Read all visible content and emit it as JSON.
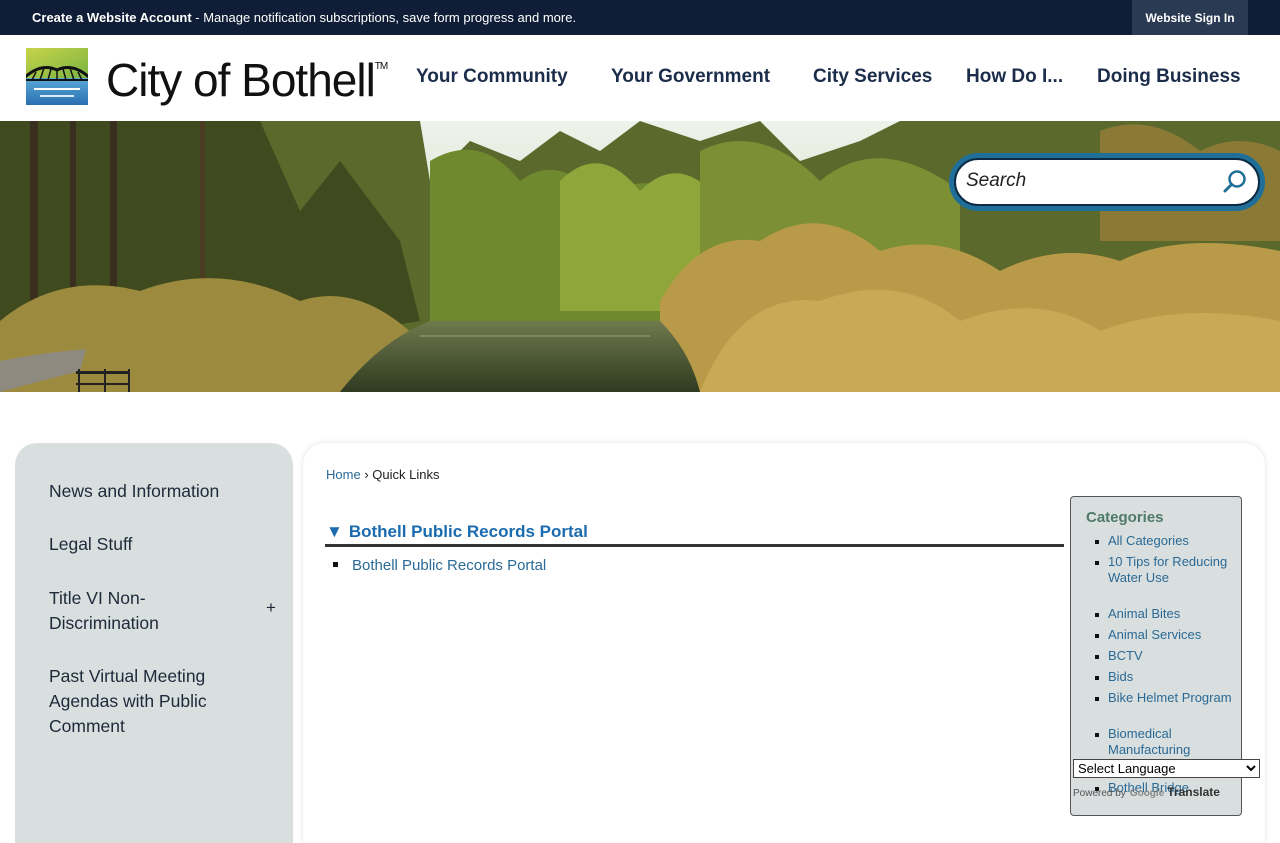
{
  "topbar": {
    "create_account": "Create a Website Account",
    "message": " - Manage notification subscriptions, save form progress and more.",
    "sign_in": "Website Sign In"
  },
  "header": {
    "logo_text": "City of Bothell",
    "logo_tm": "TM",
    "nav": [
      "Your Community",
      "Your Government",
      "City Services",
      "How Do I...",
      "Doing Business"
    ]
  },
  "search": {
    "placeholder": "Search"
  },
  "sidenav": {
    "items": [
      "News and Information",
      "Legal Stuff",
      "Title VI Non-Discrimination",
      "Past Virtual Meeting Agendas with Public Comment"
    ],
    "toggle": "+"
  },
  "breadcrumb": {
    "home": "Home",
    "separator": "›",
    "current": "Quick Links"
  },
  "content": {
    "section_title": "Bothell Public Records Portal",
    "section_arrow": "▼",
    "links": [
      "Bothell Public Records Portal"
    ]
  },
  "categories": {
    "title": "Categories",
    "items": [
      "All Categories",
      "10 Tips for Reducing Water Use",
      "Animal Bites",
      "Animal Services",
      "BCTV",
      "Bids",
      "Bike Helmet Program",
      "Biomedical Manufacturing",
      "Bothell Bridge"
    ]
  },
  "translate": {
    "select_label": "Select Language",
    "powered_by": "Powered by",
    "google": "Google",
    "translate": "Translate"
  },
  "colors": {
    "topbar": "#0f1e36",
    "nav_text": "#1b2d4a",
    "link": "#2a6a96",
    "section_title": "#1a6bb0",
    "panel": "#d9dede",
    "search_ring": "#1f6f99"
  }
}
